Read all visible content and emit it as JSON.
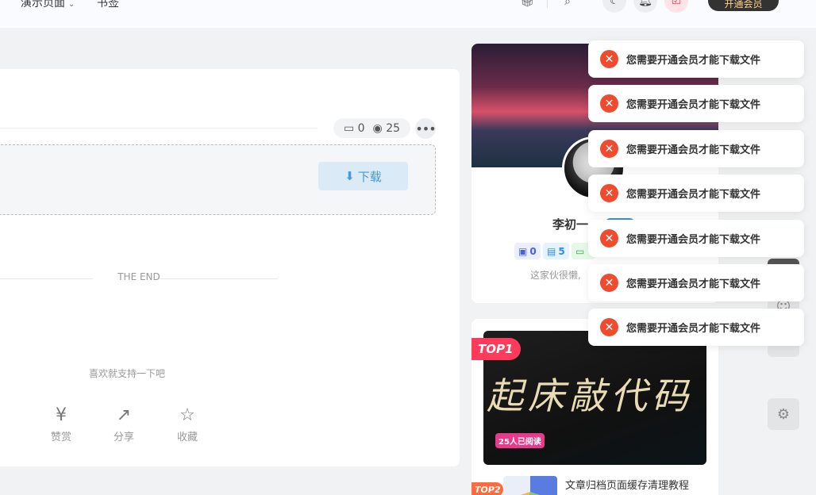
{
  "topbar": {
    "nav_demo": "演示页面",
    "nav_book": "书签",
    "vip_label": "开通会员",
    "icons": [
      "gift-icon",
      "search-icon",
      "moon-icon",
      "bell-icon",
      "task-icon"
    ]
  },
  "article": {
    "comment_count": "0",
    "view_count": "25",
    "download_label": "下载",
    "the_end": "THE END",
    "support_text": "喜欢就支持一下吧",
    "actions": {
      "reward": "赞赏",
      "share": "分享",
      "favorite": "收藏"
    }
  },
  "author": {
    "name": "李初一",
    "stats": {
      "comments": "0",
      "posts": "5"
    },
    "bio": "这家伙很懒,"
  },
  "ranking": {
    "top1_tag": "TOP1",
    "top1_image_text": "起床敲代码",
    "top1_reads": "25人已阅读",
    "top2_tag": "TOP2",
    "top2_title": "文章归档页面缓存清理教程"
  },
  "toasts": [
    "您需要开通会员才能下载文件",
    "您需要开通会员才能下载文件",
    "您需要开通会员才能下载文件",
    "您需要开通会员才能下载文件",
    "您需要开通会员才能下载文件",
    "您需要开通会员才能下载文件",
    "您需要开通会员才能下载文件"
  ],
  "colors": {
    "accent": "#4499e0",
    "danger": "#f04a2f",
    "top_tag": "#ff3b5c"
  }
}
